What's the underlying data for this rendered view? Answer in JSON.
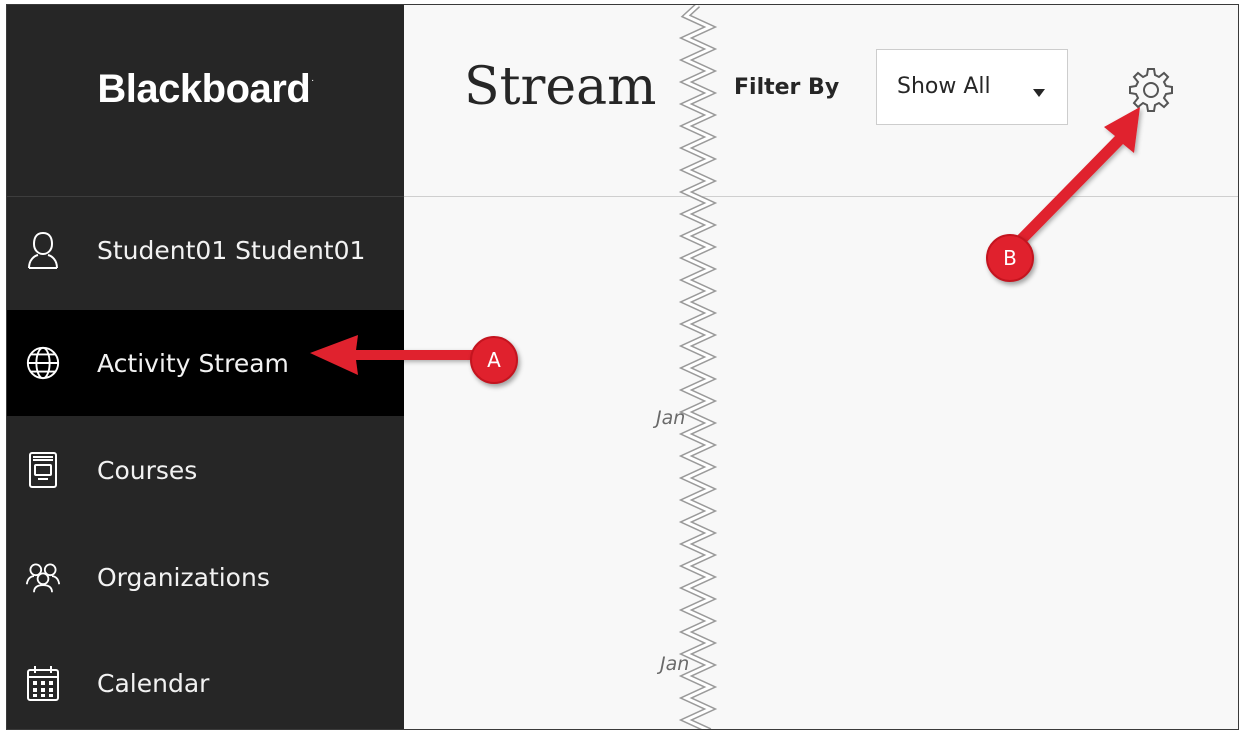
{
  "app": {
    "logo": "Blackboard",
    "logo_mark": "."
  },
  "sidebar": {
    "items": [
      {
        "label": "Student01 Student01",
        "icon": "user-icon",
        "active": false
      },
      {
        "label": "Activity Stream",
        "icon": "globe-icon",
        "active": true
      },
      {
        "label": "Courses",
        "icon": "courses-icon",
        "active": false
      },
      {
        "label": "Organizations",
        "icon": "organizations-icon",
        "active": false
      },
      {
        "label": "Calendar",
        "icon": "calendar-icon",
        "active": false
      }
    ]
  },
  "header": {
    "title": "Stream",
    "filter_label": "Filter By",
    "filter_value": "Show All",
    "settings_icon": "gear-icon"
  },
  "stream": {
    "dates": [
      "Jan",
      "Jan"
    ]
  },
  "annotations": {
    "a": "A",
    "b": "B",
    "color": "#e0212d"
  }
}
